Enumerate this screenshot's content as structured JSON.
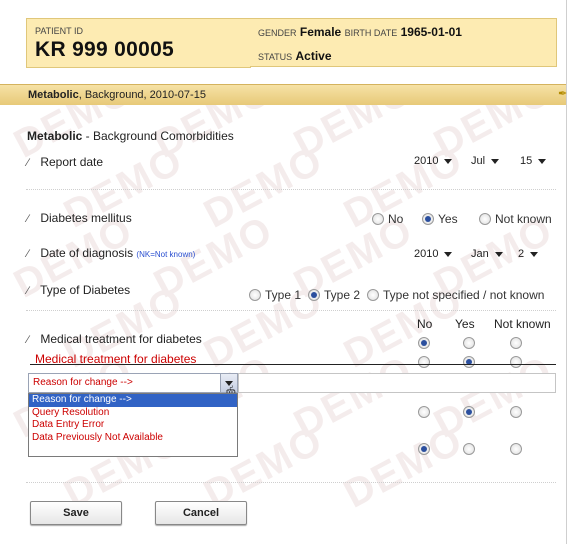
{
  "header": {
    "patient_id_label": "PATIENT ID",
    "patient_id": "KR 999 00005",
    "gender_label": "GENDER",
    "gender": "Female",
    "birth_label": "BIRTH DATE",
    "birth_date": "1965-01-01",
    "status_label": "STATUS",
    "status": "Active"
  },
  "breadcrumb": {
    "strong": "Metabolic",
    "rest": ", Background, 2010-07-15"
  },
  "form": {
    "title_strong": "Metabolic",
    "title_rest": " - Background Comorbidities",
    "report_date_label": "Report date",
    "report_date": {
      "year": "2010",
      "month": "Jul",
      "day": "15"
    },
    "diabetes_label": "Diabetes mellitus",
    "diabetes_options": [
      "No",
      "Yes",
      "Not known"
    ],
    "diagnosis_label": "Date of diagnosis",
    "diagnosis_hint": "(NK=Not known)",
    "diagnosis_date": {
      "year": "2010",
      "month": "Jan",
      "day": "2"
    },
    "type_label": "Type of Diabetes",
    "type_options": [
      "Type 1",
      "Type 2",
      "Type not specified / not known"
    ],
    "treatment_headers": [
      "No",
      "Yes",
      "Not known"
    ],
    "treatment_label": "Medical treatment for diabetes",
    "treatment_old_label": "Medical treatment for diabetes",
    "reason_select_value": "Reason for change -->",
    "reason_options": [
      "Reason for change -->",
      "Query Resolution",
      "Data Entry Error",
      "Data Previously Not Available"
    ],
    "save_label": "Save",
    "cancel_label": "Cancel"
  },
  "watermark": "DEMO"
}
